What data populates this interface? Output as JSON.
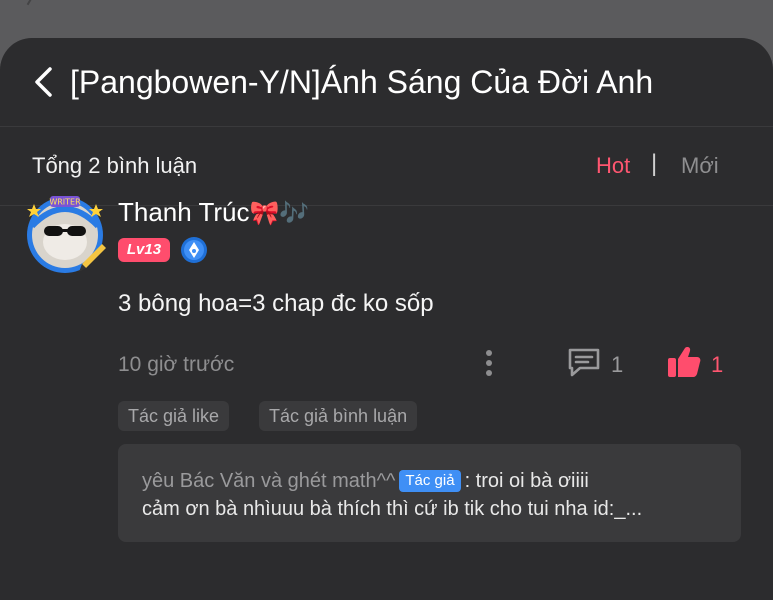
{
  "header": {
    "title": "[Pangbowen-Y/N]Ánh Sáng Của Đời Anh"
  },
  "comments_bar": {
    "count_label": "Tổng 2 bình luận",
    "sort_hot": "Hot",
    "sort_sep": "|",
    "sort_new": "Mới"
  },
  "comment": {
    "username": "Thanh Trúc",
    "username_emoji": "🎀🎶",
    "avatar_badge_text": "WRITER",
    "level": "Lv13",
    "text": "3 bông hoa=3 chap đc ko sốp",
    "time": "10 giờ trước",
    "reply_count": "1",
    "like_count": "1",
    "tags": [
      "Tác giả like",
      "Tác giả bình luận"
    ],
    "reply": {
      "author": "yêu Bác Văn và ghét math^^",
      "badge": "Tác giả",
      "text_line1": ": troi oi bà ơiiii",
      "text_line2": "cảm ơn bà nhìuuu bà thích thì cứ ib tik cho tui nha id:_..."
    }
  },
  "colors": {
    "accent": "#ff5670",
    "background": "#2c2c2e",
    "author_badge": "#3f8ff5"
  },
  "icons": [
    "chevron-left-icon",
    "more-vertical-icon",
    "reply-icon",
    "thumbs-up-icon",
    "author-badge-icon"
  ]
}
